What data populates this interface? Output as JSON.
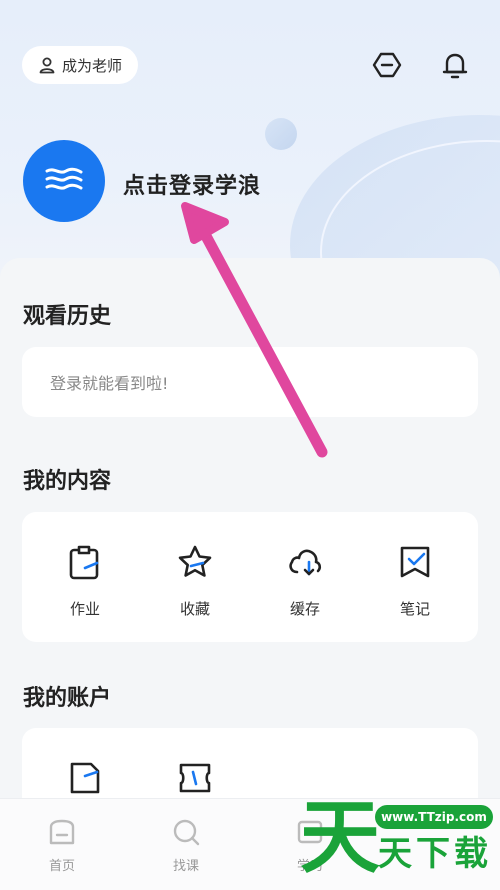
{
  "header": {
    "teacher_button_label": "成为老师"
  },
  "profile": {
    "login_prompt": "点击登录学浪"
  },
  "history": {
    "title": "观看历史",
    "empty_text": "登录就能看到啦!"
  },
  "my_content": {
    "title": "我的内容",
    "items": [
      {
        "label": "作业",
        "icon": "homework-icon"
      },
      {
        "label": "收藏",
        "icon": "star-icon"
      },
      {
        "label": "缓存",
        "icon": "cloud-download-icon"
      },
      {
        "label": "笔记",
        "icon": "notes-icon"
      }
    ]
  },
  "my_account": {
    "title": "我的账户",
    "items": [
      {
        "icon": "orders-icon"
      },
      {
        "icon": "coupon-icon"
      }
    ]
  },
  "bottom_nav": {
    "tabs": [
      {
        "label": "首页",
        "icon": "home-icon"
      },
      {
        "label": "找课",
        "icon": "search-course-icon"
      },
      {
        "label": "学习",
        "icon": "study-icon"
      }
    ]
  },
  "watermark": {
    "big_char": "天",
    "url": "www.TTzip.com",
    "name": "天下载"
  },
  "colors": {
    "accent_blue": "#1a78f0",
    "arrow_pink": "#e0479e",
    "watermark_green": "#1aa339"
  }
}
